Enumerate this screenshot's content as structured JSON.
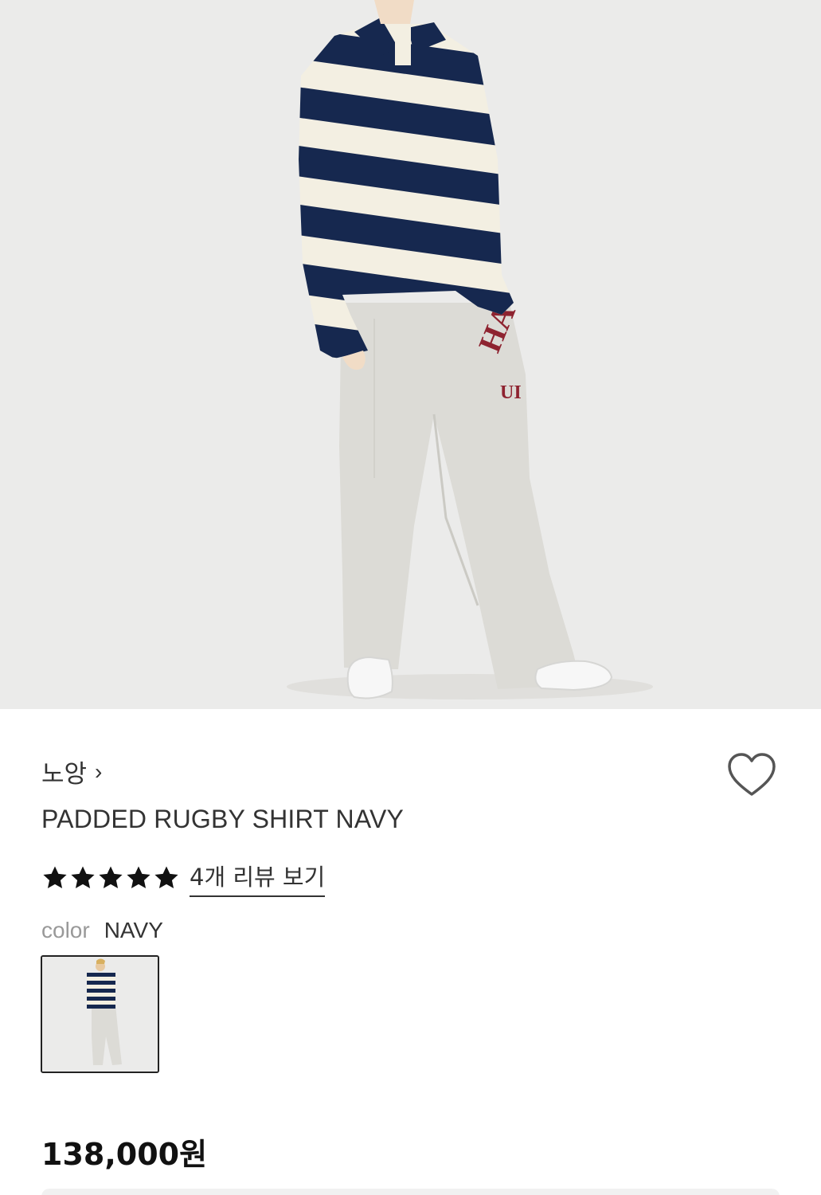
{
  "product": {
    "brand": "노앙",
    "brand_chevron": "›",
    "name": "PADDED RUGBY SHIRT NAVY",
    "rating_stars": 5,
    "rating_max": 5,
    "review_link": "4개 리뷰 보기",
    "color_label": "color",
    "color_value": "NAVY",
    "price": "138,000원"
  },
  "photo": {
    "pants_print_line1": "HA",
    "pants_print_line2": "UI"
  },
  "colors": {
    "navy": "#16284f",
    "cream": "#f3efe2",
    "heather_grey": "#dcdbd6",
    "print_red": "#8e2330",
    "background": "#ebebea"
  },
  "icons": {
    "wishlist": "heart-outline-icon",
    "star": "star-filled-icon",
    "chevron": "chevron-right-icon"
  }
}
